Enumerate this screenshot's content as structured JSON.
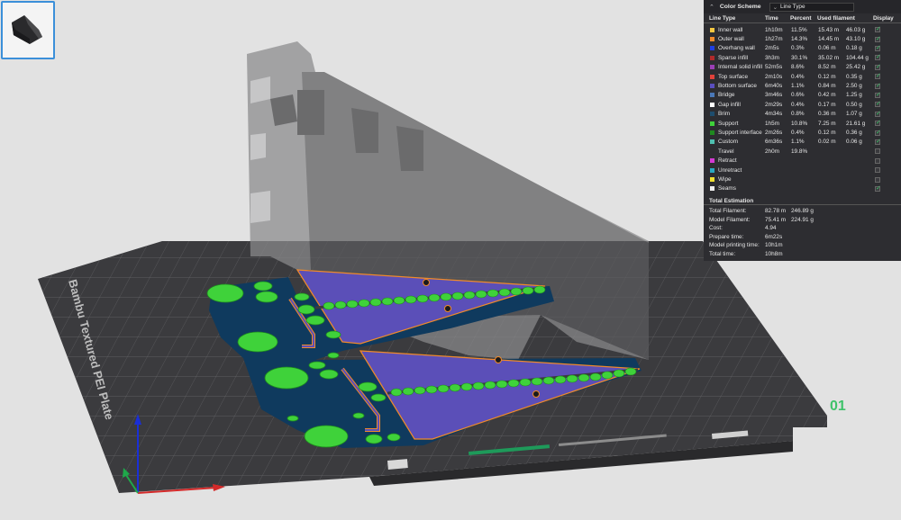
{
  "bed_label": "Bambu Textured PEI Plate",
  "plate_number": "01",
  "color_scheme": {
    "title": "Color Scheme",
    "selected": "Line Type"
  },
  "table": {
    "headers": [
      "Line Type",
      "Time",
      "Percent",
      "Used filament",
      "Display"
    ],
    "rows": [
      {
        "name": "Inner wall",
        "color": "#f5c842",
        "time": "1h10m",
        "percent": "11.5%",
        "length": "15.43 m",
        "weight": "46.03 g",
        "on": true
      },
      {
        "name": "Outer wall",
        "color": "#f08a2a",
        "time": "1h27m",
        "percent": "14.3%",
        "length": "14.45 m",
        "weight": "43.10 g",
        "on": true
      },
      {
        "name": "Overhang wall",
        "color": "#1f3fe0",
        "time": "2m5s",
        "percent": "0.3%",
        "length": "0.06 m",
        "weight": "0.18 g",
        "on": true
      },
      {
        "name": "Sparse infill",
        "color": "#b02a2a",
        "time": "3h3m",
        "percent": "30.1%",
        "length": "35.02 m",
        "weight": "104.44 g",
        "on": true
      },
      {
        "name": "Internal solid infill",
        "color": "#9b3fb5",
        "time": "52m5s",
        "percent": "8.6%",
        "length": "8.52 m",
        "weight": "25.42 g",
        "on": true
      },
      {
        "name": "Top surface",
        "color": "#e0423a",
        "time": "2m10s",
        "percent": "0.4%",
        "length": "0.12 m",
        "weight": "0.35 g",
        "on": true
      },
      {
        "name": "Bottom surface",
        "color": "#5a4fc0",
        "time": "6m40s",
        "percent": "1.1%",
        "length": "0.84 m",
        "weight": "2.50 g",
        "on": true
      },
      {
        "name": "Bridge",
        "color": "#4a78b8",
        "time": "3m46s",
        "percent": "0.6%",
        "length": "0.42 m",
        "weight": "1.25 g",
        "on": true
      },
      {
        "name": "Gap infill",
        "color": "#ffffff",
        "time": "2m29s",
        "percent": "0.4%",
        "length": "0.17 m",
        "weight": "0.50 g",
        "on": true
      },
      {
        "name": "Brim",
        "color": "#1e4d6e",
        "time": "4m34s",
        "percent": "0.8%",
        "length": "0.36 m",
        "weight": "1.07 g",
        "on": true
      },
      {
        "name": "Support",
        "color": "#3fd23a",
        "time": "1h5m",
        "percent": "10.8%",
        "length": "7.25 m",
        "weight": "21.61 g",
        "on": true
      },
      {
        "name": "Support interface",
        "color": "#1f8a1f",
        "time": "2m26s",
        "percent": "0.4%",
        "length": "0.12 m",
        "weight": "0.36 g",
        "on": true
      },
      {
        "name": "Custom",
        "color": "#4fc0b0",
        "time": "6m36s",
        "percent": "1.1%",
        "length": "0.02 m",
        "weight": "0.06 g",
        "on": true
      },
      {
        "name": "Travel",
        "color": "#2d2d31",
        "time": "2h0m",
        "percent": "19.8%",
        "length": "",
        "weight": "",
        "on": false
      },
      {
        "name": "Retract",
        "color": "#d43ad4",
        "time": "",
        "percent": "",
        "length": "",
        "weight": "",
        "on": false
      },
      {
        "name": "Unretract",
        "color": "#2aa8c0",
        "time": "",
        "percent": "",
        "length": "",
        "weight": "",
        "on": false
      },
      {
        "name": "Wipe",
        "color": "#f0e030",
        "time": "",
        "percent": "",
        "length": "",
        "weight": "",
        "on": false
      },
      {
        "name": "Seams",
        "color": "#f0f0f0",
        "time": "",
        "percent": "",
        "length": "",
        "weight": "",
        "on": true
      }
    ]
  },
  "total_estimation": {
    "title": "Total Estimation",
    "items": [
      {
        "label": "Total Filament:",
        "v1": "82.78 m",
        "v2": "246.89 g"
      },
      {
        "label": "Model Filament:",
        "v1": "75.41 m",
        "v2": "224.91 g"
      },
      {
        "label": "Cost:",
        "v1": "4.94",
        "v2": ""
      },
      {
        "label": "Prepare time:",
        "v1": "6m22s",
        "v2": ""
      },
      {
        "label": "Model printing time:",
        "v1": "10h1m",
        "v2": ""
      },
      {
        "label": "Total time:",
        "v1": "10h8m",
        "v2": ""
      }
    ]
  },
  "colors": {
    "panel_bg": "#2d2d31",
    "bed": "#3b3b3e",
    "accent": "#3fc26a",
    "support": "#3fd23a",
    "brim": "#0f3a5e",
    "model": "#5b4fb8",
    "selection": "#3b8fd9"
  },
  "icons": [
    "color-scheme-icon",
    "dropdown-chevron-icon",
    "axis-gizmo-icon",
    "plate-thumbnail-icon"
  ]
}
